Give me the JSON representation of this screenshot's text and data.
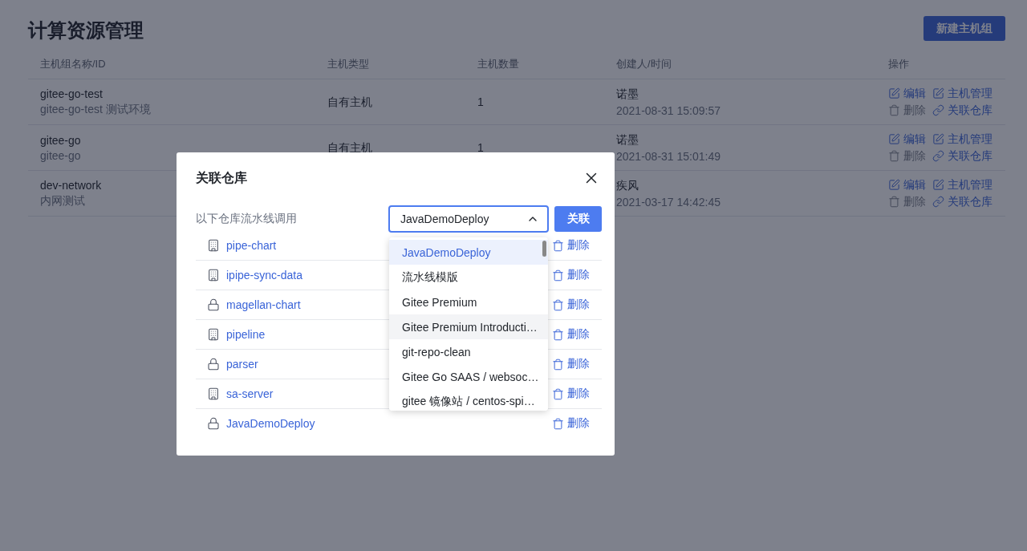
{
  "page": {
    "title": "计算资源管理",
    "new_button": "新建主机组"
  },
  "table": {
    "columns": [
      "主机组名称/ID",
      "主机类型",
      "主机数量",
      "创建人/时间",
      "操作"
    ],
    "rows": [
      {
        "name": "gitee-go-test",
        "description": "gitee-go-test 测试环境",
        "host_type": "自有主机",
        "host_count": "1",
        "creator": "诺墨",
        "created_at": "2021-08-31 15:09:57",
        "actions": [
          {
            "kind": "edit",
            "label": "编辑",
            "disabled": false
          },
          {
            "kind": "manage",
            "label": "主机管理",
            "disabled": false
          },
          {
            "kind": "delete",
            "label": "删除",
            "disabled": true
          },
          {
            "kind": "link",
            "label": "关联仓库",
            "disabled": false
          }
        ]
      },
      {
        "name": "gitee-go",
        "description": "gitee-go",
        "host_type": "自有主机",
        "host_count": "1",
        "creator": "诺墨",
        "created_at": "2021-08-31 15:01:49",
        "actions": [
          {
            "kind": "edit",
            "label": "编辑",
            "disabled": false
          },
          {
            "kind": "manage",
            "label": "主机管理",
            "disabled": false
          },
          {
            "kind": "delete",
            "label": "删除",
            "disabled": true
          },
          {
            "kind": "link",
            "label": "关联仓库",
            "disabled": false
          }
        ]
      },
      {
        "name": "dev-network",
        "description": "内网测试",
        "creator": "疾风",
        "created_at": "2021-03-17 14:42:45",
        "actions": [
          {
            "kind": "edit",
            "label": "编辑",
            "disabled": false
          },
          {
            "kind": "manage",
            "label": "主机管理",
            "disabled": false
          },
          {
            "kind": "delete",
            "label": "删除",
            "disabled": true
          },
          {
            "kind": "link",
            "label": "关联仓库",
            "disabled": false
          }
        ]
      }
    ]
  },
  "dialog": {
    "title": "关联仓库",
    "label": "以下仓库流水线调用",
    "confirm_button": "关联",
    "select": {
      "value": "JavaDemoDeploy",
      "expanded": true,
      "options": [
        {
          "label": "JavaDemoDeploy",
          "selected": true,
          "hovered": false
        },
        {
          "label": "流水线模版",
          "selected": false,
          "hovered": false
        },
        {
          "label": "Gitee Premium",
          "selected": false,
          "hovered": false
        },
        {
          "label": "Gitee Premium Introducti…",
          "selected": false,
          "hovered": true
        },
        {
          "label": "git-repo-clean",
          "selected": false,
          "hovered": false
        },
        {
          "label": "Gitee Go SAAS / websoc…",
          "selected": false,
          "hovered": false
        },
        {
          "label": "gitee 镜像站 / centos-spi…",
          "selected": false,
          "hovered": false
        }
      ]
    },
    "repos": [
      {
        "name": "pipe-chart",
        "kind": "public",
        "delete_label": "删除"
      },
      {
        "name": "ipipe-sync-data",
        "kind": "public",
        "delete_label": "删除"
      },
      {
        "name": "magellan-chart",
        "kind": "private",
        "delete_label": "删除"
      },
      {
        "name": "pipeline",
        "kind": "public",
        "delete_label": "删除"
      },
      {
        "name": "parser",
        "kind": "private",
        "delete_label": "删除"
      },
      {
        "name": "sa-server",
        "kind": "public",
        "delete_label": "删除"
      },
      {
        "name": "JavaDemoDeploy",
        "kind": "private",
        "delete_label": "删除"
      }
    ]
  }
}
